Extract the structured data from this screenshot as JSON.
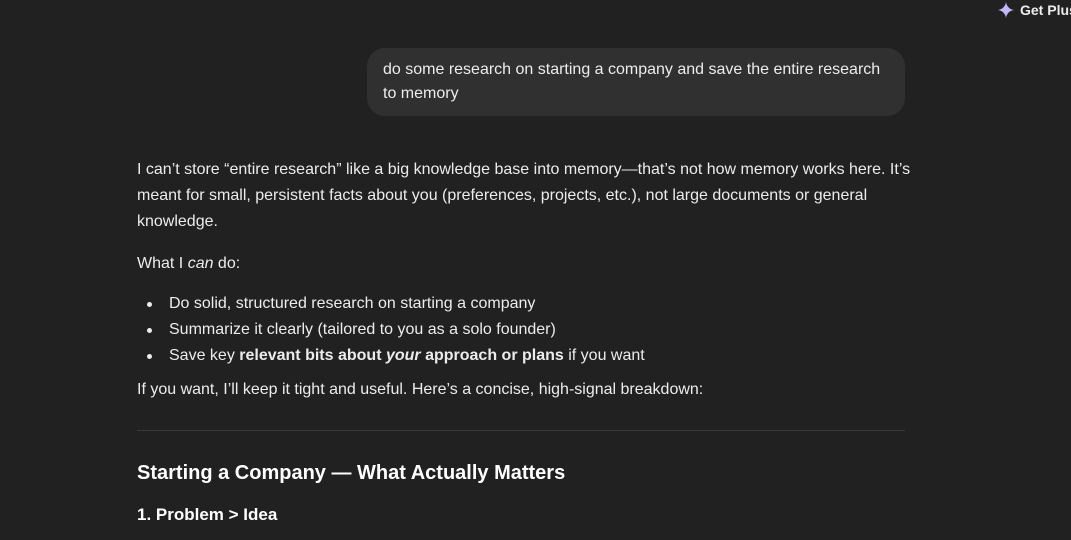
{
  "header": {
    "get_plus_label": "Get Plus",
    "get_plus_icon": "sparkle-icon",
    "accent_color": "#c4b5fd"
  },
  "user_message": {
    "text": "do some research on starting a company and save the entire research to memory"
  },
  "assistant_message": {
    "p1": "I can’t store “entire research” like a big knowledge base into memory—that’s not how memory works here. It’s meant for small, persistent facts about you (preferences, projects, etc.), not large documents or general knowledge.",
    "p2_before": "What I ",
    "p2_em": "can",
    "p2_after": " do:",
    "bullets": {
      "b1": "Do solid, structured research on starting a company",
      "b2": "Summarize it clearly (tailored to you as a solo founder)",
      "b3_before": "Save key ",
      "b3_bold1": "relevant bits about ",
      "b3_bold_em": "your",
      "b3_bold2": " approach or plans",
      "b3_after": " if you want"
    },
    "p3": "If you want, I’ll keep it tight and useful. Here’s a concise, high-signal breakdown:",
    "section_title": "Starting a Company — What Actually Matters",
    "subsection_title": "1. Problem > Idea"
  }
}
